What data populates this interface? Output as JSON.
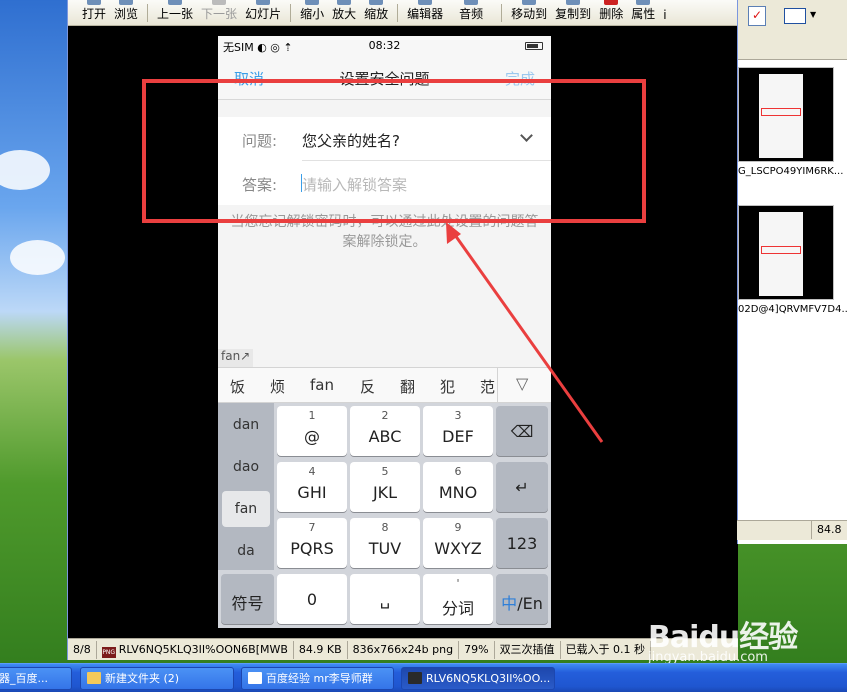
{
  "viewer": {
    "toolbar": [
      "打开",
      "浏览",
      "上一张",
      "下一张",
      "幻灯片",
      "缩小",
      "放大",
      "缩放",
      "编辑器",
      "音频",
      "移动到",
      "复制到",
      "删除",
      "属性",
      "i"
    ],
    "status": {
      "index": "8/8",
      "filename": "RLV6NQ5KLQ3II%OON6B[MWB",
      "size": "84.9 KB",
      "dims": "836x766x24b png",
      "zoom": "79%",
      "interp": "双三次插值",
      "load": "已载入于 0.1 秒"
    }
  },
  "phone": {
    "status_left": "无SIM ◐ ◎ ⇡",
    "time": "08:32",
    "nav": {
      "cancel": "取消",
      "title": "设置安全问题",
      "done": "完成"
    },
    "question_label": "问题:",
    "question_value": "您父亲的姓名?",
    "answer_label": "答案:",
    "answer_placeholder": "请输入解锁答案",
    "hint": "当您忘记解锁密码时，可以通过此处设置的问题答案解除锁定。",
    "ime_tag": "fan↗",
    "candidates": [
      "饭",
      "烦",
      "fan",
      "反",
      "翻",
      "犯",
      "范"
    ],
    "expand_glyph": "▽",
    "pinyin": [
      "dan",
      "dao",
      "fan",
      "da"
    ],
    "keys": [
      {
        "num": "1",
        "main": "@"
      },
      {
        "num": "2",
        "main": "ABC"
      },
      {
        "num": "3",
        "main": "DEF"
      },
      {
        "num": "4",
        "main": "GHI"
      },
      {
        "num": "5",
        "main": "JKL"
      },
      {
        "num": "6",
        "main": "MNO"
      },
      {
        "num": "7",
        "main": "PQRS"
      },
      {
        "num": "8",
        "main": "TUV"
      },
      {
        "num": "9",
        "main": "WXYZ"
      }
    ],
    "backspace": "⌫",
    "enter": "↵",
    "num_key": "123",
    "symbol_key": "符号",
    "zero_key": "0",
    "space_key": "␣",
    "fenci_top": "'",
    "fenci": "分词",
    "lang_zh": "中",
    "lang_en": "/En"
  },
  "explorer": {
    "caption1": "G_LSCPO49YIM6RK...",
    "caption2": "02D@4]QRVMFV7D4...",
    "status": "84.8"
  },
  "taskbar": {
    "items": [
      "器_百度...",
      "新建文件夹 (2)",
      "百度经验 mr李导师群",
      "RLV6NQ5KLQ3II%OO..."
    ]
  },
  "watermark": {
    "logo": "Baidu经验",
    "url": "jingyan.baidu.com"
  },
  "colors": {
    "annotation_red": "#ea3f3f",
    "ios_blue": "#3a9ee8"
  }
}
